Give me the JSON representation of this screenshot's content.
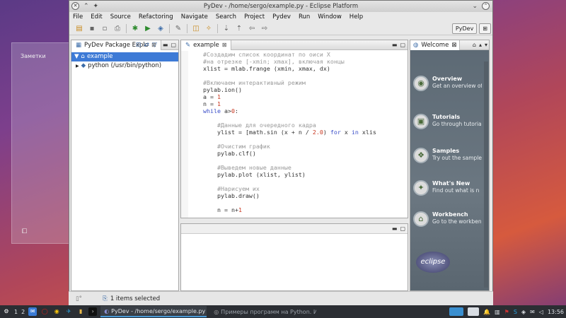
{
  "desktop": {
    "note_title": "Заметки",
    "note_glyph": "⧠"
  },
  "window": {
    "title": "PyDev - /home/sergo/example.py - Eclipse Platform"
  },
  "menu": [
    "File",
    "Edit",
    "Source",
    "Refactoring",
    "Navigate",
    "Search",
    "Project",
    "Pydev",
    "Run",
    "Window",
    "Help"
  ],
  "perspective": {
    "label": "PyDev"
  },
  "explorer": {
    "tab": "PyDev Package Explo",
    "items": [
      {
        "label": "example",
        "expander": "▼",
        "icon": "project-icon"
      },
      {
        "label": "python  (/usr/bin/python)",
        "expander": "▶",
        "icon": "python-icon"
      }
    ]
  },
  "editor": {
    "tab": "example",
    "lines": [
      [
        {
          "c": "cm",
          "t": "#Создадим список координат по оиси X"
        }
      ],
      [
        {
          "c": "cm",
          "t": "#на отрезке [-xmin; xmax], включая концы"
        }
      ],
      [
        {
          "c": "op",
          "t": "xlist = mlab.frange (xmin, xmax, dx)"
        }
      ],
      [
        {
          "c": "op",
          "t": ""
        }
      ],
      [
        {
          "c": "cm",
          "t": "#Включаем интерактивный режим"
        }
      ],
      [
        {
          "c": "op",
          "t": "pylab.ion()"
        }
      ],
      [
        {
          "c": "op",
          "t": "a = "
        },
        {
          "c": "num",
          "t": "1"
        }
      ],
      [
        {
          "c": "op",
          "t": "n = "
        },
        {
          "c": "num",
          "t": "1"
        }
      ],
      [
        {
          "c": "kw",
          "t": "while"
        },
        {
          "c": "op",
          "t": " a>"
        },
        {
          "c": "num",
          "t": "0"
        },
        {
          "c": "op",
          "t": ":"
        }
      ],
      [
        {
          "c": "op",
          "t": ""
        }
      ],
      [
        {
          "c": "cm",
          "t": "    #Данные для очередного кадра"
        }
      ],
      [
        {
          "c": "op",
          "t": "    ylist = [math.sin (x + n / "
        },
        {
          "c": "num",
          "t": "2.0"
        },
        {
          "c": "op",
          "t": ") "
        },
        {
          "c": "kw",
          "t": "for"
        },
        {
          "c": "op",
          "t": " x "
        },
        {
          "c": "kw",
          "t": "in"
        },
        {
          "c": "op",
          "t": " xlist]"
        }
      ],
      [
        {
          "c": "op",
          "t": ""
        }
      ],
      [
        {
          "c": "cm",
          "t": "    #Очистим график"
        }
      ],
      [
        {
          "c": "op",
          "t": "    pylab.clf()"
        }
      ],
      [
        {
          "c": "op",
          "t": ""
        }
      ],
      [
        {
          "c": "cm",
          "t": "    #Выведем новые данные"
        }
      ],
      [
        {
          "c": "op",
          "t": "    pylab.plot (xlist, ylist)"
        }
      ],
      [
        {
          "c": "op",
          "t": ""
        }
      ],
      [
        {
          "c": "cm",
          "t": "    #Нарисуем их"
        }
      ],
      [
        {
          "c": "op",
          "t": "    pylab.draw()"
        }
      ],
      [
        {
          "c": "op",
          "t": ""
        }
      ],
      [
        {
          "c": "op",
          "t": "    n = n+"
        },
        {
          "c": "num",
          "t": "1"
        }
      ]
    ]
  },
  "welcome": {
    "tab": "Welcome",
    "items": [
      {
        "title": "Overview",
        "sub": "Get an overview of features",
        "icon": "overview-icon"
      },
      {
        "title": "Tutorials",
        "sub": "Go through tutorial",
        "icon": "tutorials-icon"
      },
      {
        "title": "Samples",
        "sub": "Try out the sample",
        "icon": "samples-icon"
      },
      {
        "title": "What's New",
        "sub": "Find out what is n",
        "icon": "whats-new-icon"
      },
      {
        "title": "Workbench",
        "sub": "Go to the workben",
        "icon": "workbench-icon"
      }
    ],
    "logo": "eclipse"
  },
  "status": {
    "selection": "1 items selected"
  },
  "taskbar": {
    "desktops": [
      "1",
      "2"
    ],
    "tasks": [
      {
        "label": "PyDev - /home/sergo/example.py - Ec",
        "active": true
      },
      {
        "label": "Примеры программ на Python. Исхо",
        "active": false
      }
    ],
    "clock": "13:56"
  }
}
